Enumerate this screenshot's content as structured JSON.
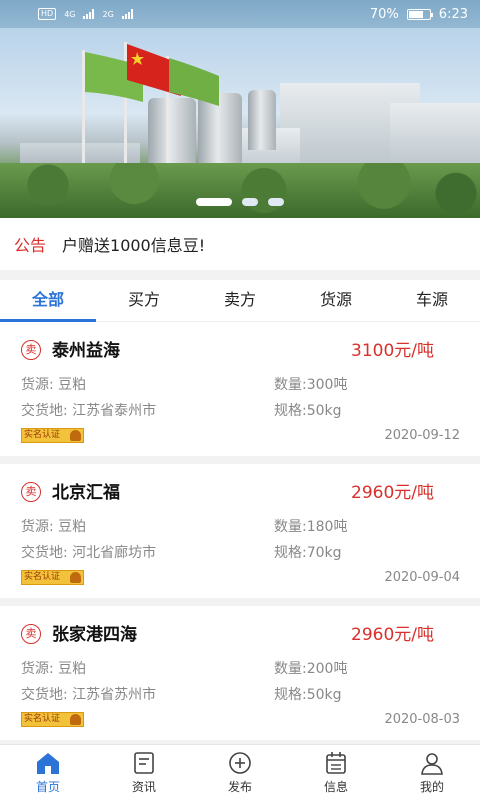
{
  "status_bar": {
    "time": "6:23",
    "battery": "70%",
    "battery_level": 0.7,
    "network_1": "4G",
    "network_2": "2G",
    "hd_label": "HD"
  },
  "banner": {
    "slides": 3,
    "active_slide": 0
  },
  "notice": {
    "tag": "公告",
    "text": "户赠送1000信息豆!"
  },
  "tabs": [
    {
      "label": "全部",
      "active": true
    },
    {
      "label": "买方",
      "active": false
    },
    {
      "label": "卖方",
      "active": false
    },
    {
      "label": "货源",
      "active": false
    },
    {
      "label": "车源",
      "active": false
    }
  ],
  "listings": [
    {
      "badge": "卖",
      "company": "泰州益海",
      "price": "3100元/吨",
      "goods_label": "货源:",
      "goods": "豆粕",
      "qty_label": "数量:",
      "qty": "300吨",
      "place_label": "交货地:",
      "place": "江苏省泰州市",
      "spec_label": "规格:",
      "spec": "50kg",
      "verify": "实名认证",
      "date": "2020-09-12"
    },
    {
      "badge": "卖",
      "company": "北京汇福",
      "price": "2960元/吨",
      "goods_label": "货源:",
      "goods": "豆粕",
      "qty_label": "数量:",
      "qty": "180吨",
      "place_label": "交货地:",
      "place": "河北省廊坊市",
      "spec_label": "规格:",
      "spec": "70kg",
      "verify": "实名认证",
      "date": "2020-09-04"
    },
    {
      "badge": "卖",
      "company": "张家港四海",
      "price": "2960元/吨",
      "goods_label": "货源:",
      "goods": "豆粕",
      "qty_label": "数量:",
      "qty": "200吨",
      "place_label": "交货地:",
      "place": "江苏省苏州市",
      "spec_label": "规格:",
      "spec": "50kg",
      "verify": "实名认证",
      "date": "2020-08-03"
    }
  ],
  "bottom_nav": [
    {
      "label": "首页",
      "icon": "home-icon",
      "active": true
    },
    {
      "label": "资讯",
      "icon": "news-icon",
      "active": false
    },
    {
      "label": "发布",
      "icon": "publish-icon",
      "active": false
    },
    {
      "label": "信息",
      "icon": "calendar-icon",
      "active": false
    },
    {
      "label": "我的",
      "icon": "profile-icon",
      "active": false
    }
  ],
  "colors": {
    "accent": "#2b73d6",
    "price": "#d9302c",
    "notice_tag": "#d9302c"
  }
}
